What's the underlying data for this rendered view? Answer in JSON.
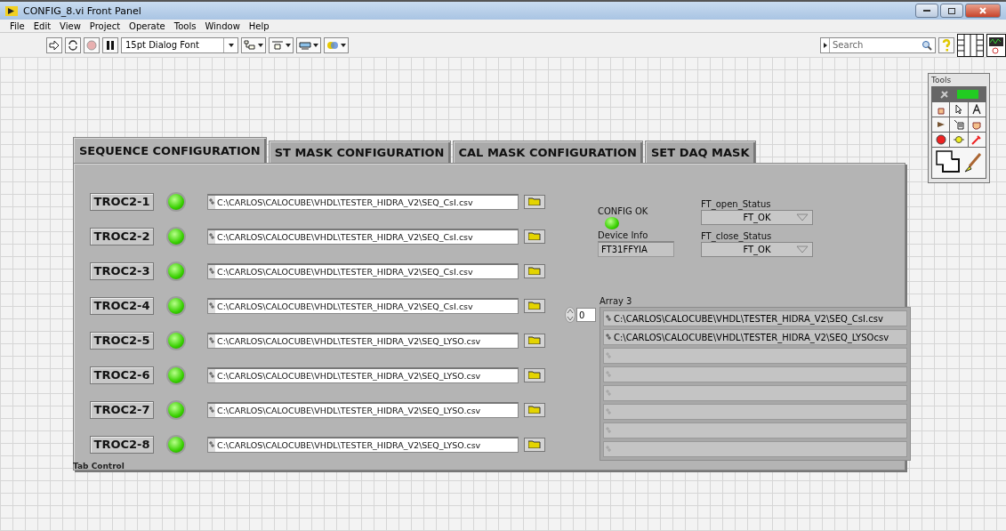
{
  "window": {
    "title": "CONFIG_8.vi Front Panel"
  },
  "menu": [
    "File",
    "Edit",
    "View",
    "Project",
    "Operate",
    "Tools",
    "Window",
    "Help"
  ],
  "toolbar": {
    "font": "15pt Dialog Font",
    "search": {
      "placeholder": "Search"
    }
  },
  "tools_palette": {
    "title": "Tools"
  },
  "tab_control": {
    "label": "Tab Control",
    "tabs": [
      {
        "label": "SEQUENCE CONFIGURATION",
        "selected": true
      },
      {
        "label": "ST MASK CONFIGURATION",
        "selected": false
      },
      {
        "label": "CAL MASK CONFIGURATION",
        "selected": false
      },
      {
        "label": "SET DAQ MASK",
        "selected": false
      }
    ]
  },
  "troc_rows": [
    {
      "button": "TROC2-1",
      "on": true,
      "path": "C:\\CARLOS\\CALOCUBE\\VHDL\\TESTER_HIDRA_V2\\SEQ_CsI.csv"
    },
    {
      "button": "TROC2-2",
      "on": true,
      "path": "C:\\CARLOS\\CALOCUBE\\VHDL\\TESTER_HIDRA_V2\\SEQ_CsI.csv"
    },
    {
      "button": "TROC2-3",
      "on": true,
      "path": "C:\\CARLOS\\CALOCUBE\\VHDL\\TESTER_HIDRA_V2\\SEQ_CsI.csv"
    },
    {
      "button": "TROC2-4",
      "on": true,
      "path": "C:\\CARLOS\\CALOCUBE\\VHDL\\TESTER_HIDRA_V2\\SEQ_CsI.csv"
    },
    {
      "button": "TROC2-5",
      "on": true,
      "path": "C:\\CARLOS\\CALOCUBE\\VHDL\\TESTER_HIDRA_V2\\SEQ_LYSO.csv"
    },
    {
      "button": "TROC2-6",
      "on": true,
      "path": "C:\\CARLOS\\CALOCUBE\\VHDL\\TESTER_HIDRA_V2\\SEQ_LYSO.csv"
    },
    {
      "button": "TROC2-7",
      "on": true,
      "path": "C:\\CARLOS\\CALOCUBE\\VHDL\\TESTER_HIDRA_V2\\SEQ_LYSO.csv"
    },
    {
      "button": "TROC2-8",
      "on": true,
      "path": "C:\\CARLOS\\CALOCUBE\\VHDL\\TESTER_HIDRA_V2\\SEQ_LYSO.csv"
    }
  ],
  "config_ok": {
    "label": "CONFIG OK",
    "on": true
  },
  "device_info": {
    "label": "Device Info",
    "value": "FT31FFYIA"
  },
  "ft_open_status": {
    "label": "FT_open_Status",
    "value": "FT_OK"
  },
  "ft_close_status": {
    "label": "FT_close_Status",
    "value": "FT_OK"
  },
  "array": {
    "label": "Array 3",
    "index": "0",
    "elements": [
      "C:\\CARLOS\\CALOCUBE\\VHDL\\TESTER_HIDRA_V2\\SEQ_CsI.csv",
      "C:\\CARLOS\\CALOCUBE\\VHDL\\TESTER_HIDRA_V2\\SEQ_LYSOcsv"
    ]
  }
}
